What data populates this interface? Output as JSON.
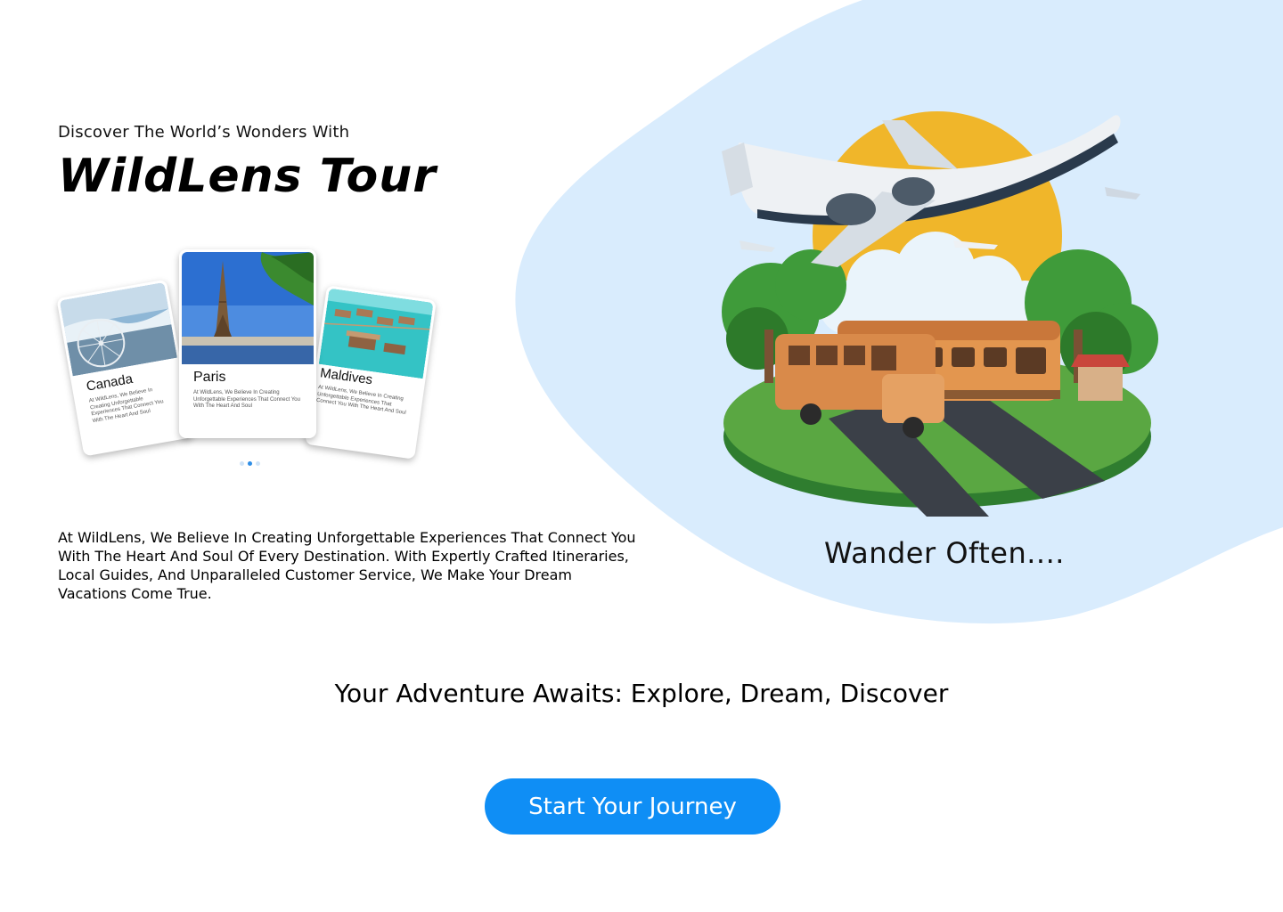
{
  "hero": {
    "kicker": "Discover The World’s Wonders With",
    "brand": "WildLens Tour",
    "about": "At WildLens, We Believe In Creating Unforgettable Experiences That Connect You With The Heart And Soul Of Every Destination. With Expertly Crafted Itineraries, Local Guides, And Unparalleled Customer Service, We Make Your Dream Vacations Come True.",
    "tagline": "Wander Often....",
    "subheading": "Your Adventure Awaits: Explore, Dream, Discover",
    "cta_label": "Start Your Journey"
  },
  "destinations": [
    {
      "title": "Canada",
      "desc": "At WildLens, We Believe In Creating Unforgettable Experiences That Connect You With The Heart And Soul"
    },
    {
      "title": "Paris",
      "desc": "At WildLens, We Believe In Creating Unforgettable Experiences That Connect You With The Heart And Soul"
    },
    {
      "title": "Maldives",
      "desc": "At WildLens, We Believe In Creating Unforgettable Experiences That Connect You With The Heart And Soul"
    }
  ],
  "carousel": {
    "active_index": 1,
    "page_count": 3
  },
  "colors": {
    "accent": "#0f8ef5",
    "blob": "#d9ecfd",
    "sun": "#f0b62a"
  },
  "icons": [
    "airplane-icon",
    "train-icon",
    "bus-icon"
  ]
}
